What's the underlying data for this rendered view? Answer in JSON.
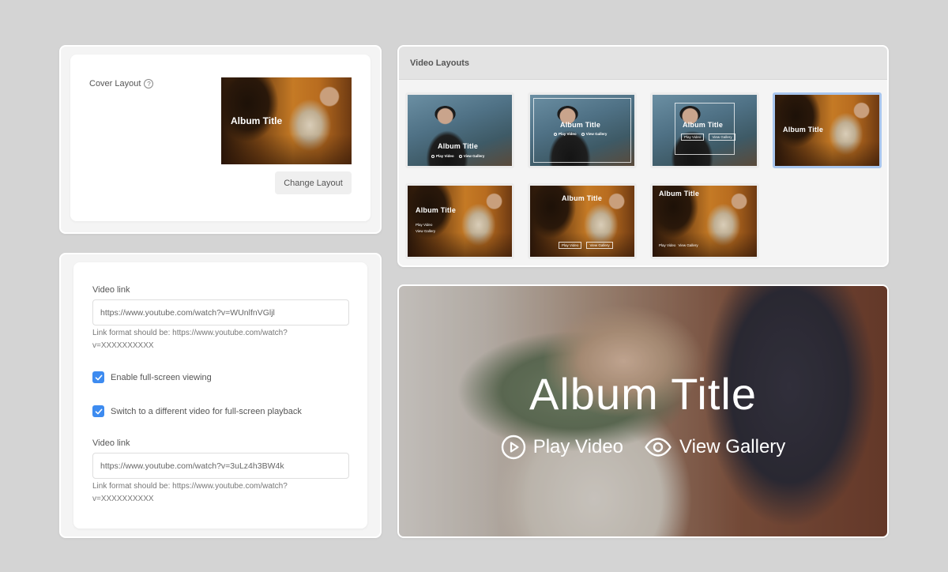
{
  "cover": {
    "label": "Cover Layout",
    "help_glyph": "?",
    "thumb_title": "Album Title",
    "change_button": "Change Layout"
  },
  "layouts": {
    "header": "Video Layouts",
    "selected_index": 3,
    "tiles": [
      {
        "title": "Album Title",
        "play": "Play Video",
        "gallery": "View Gallery"
      },
      {
        "title": "Album Title",
        "play": "Play Video",
        "gallery": "View Gallery"
      },
      {
        "title": "Album Title",
        "play": "Play Video",
        "gallery": "View Gallery"
      },
      {
        "title": "Album Title"
      },
      {
        "title": "Album Title",
        "play": "Play Video",
        "gallery": "View Gallery"
      },
      {
        "title": "Album Title",
        "play": "Play Video",
        "gallery": "View Gallery"
      },
      {
        "title": "Album Title",
        "play": "Play Video",
        "gallery": "View Gallery"
      }
    ]
  },
  "video": {
    "link1_label": "Video link",
    "link1_value": "https://www.youtube.com/watch?v=WUnlfnVGljl",
    "link1_hint": "Link format should be: https://www.youtube.com/watch?v=XXXXXXXXXX",
    "fullscreen_label": "Enable full-screen viewing",
    "fullscreen_checked": true,
    "switch_label": "Switch to a different video for full-screen playback",
    "switch_checked": true,
    "link2_label": "Video link",
    "link2_value": "https://www.youtube.com/watch?v=3uLz4h3BW4k",
    "link2_hint": "Link format should be: https://www.youtube.com/watch?v=XXXXXXXXXX"
  },
  "preview": {
    "title": "Album Title",
    "play": "Play Video",
    "gallery": "View Gallery"
  },
  "colors": {
    "accent": "#3d8bf0",
    "selected_border": "#a9c6ee",
    "background": "#d4d4d4"
  },
  "icons": {
    "play": "play-circle-icon",
    "gallery": "eye-icon",
    "check": "checkmark-icon",
    "help": "question-circle-icon"
  }
}
